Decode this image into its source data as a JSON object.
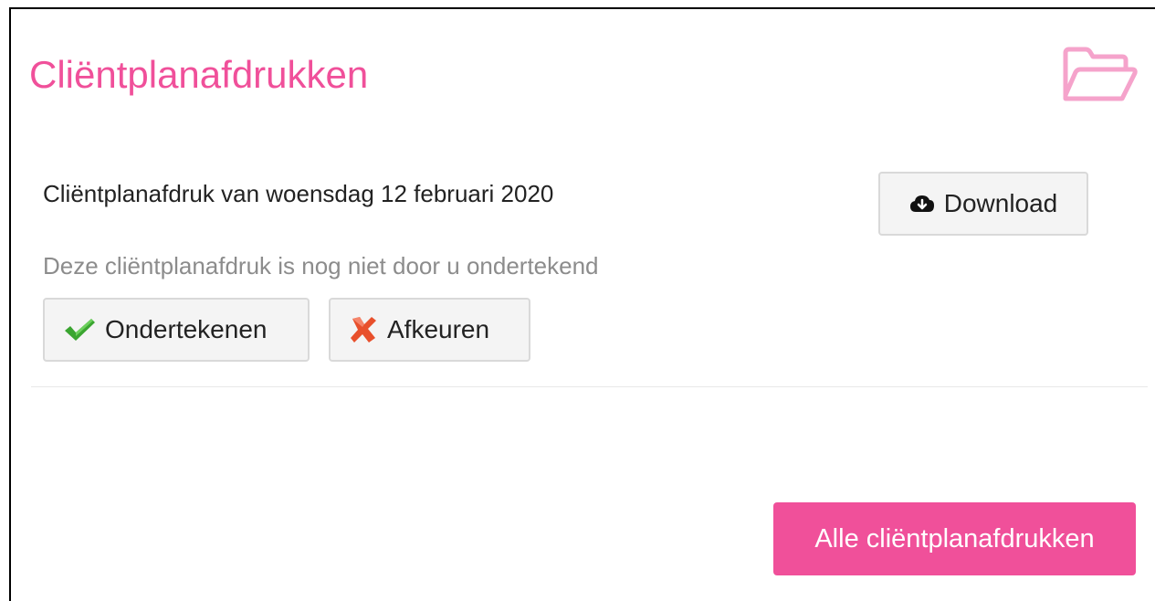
{
  "panel": {
    "title": "Cliëntplanafdrukken",
    "header_icon": "folder-open-icon"
  },
  "item": {
    "title": "Cliëntplanafdruk van woensdag 12 februari 2020",
    "status": "Deze cliëntplanafdruk is nog niet door u ondertekend",
    "download_label": "Download",
    "download_icon": "cloud-download-icon",
    "sign_label": "Ondertekenen",
    "sign_icon": "checkmark-icon",
    "reject_label": "Afkeuren",
    "reject_icon": "cross-icon"
  },
  "footer": {
    "all_label": "Alle cliëntplanafdrukken"
  },
  "colors": {
    "accent": "#f0509a",
    "check": "#3aa530",
    "cross": "#e8502c"
  }
}
